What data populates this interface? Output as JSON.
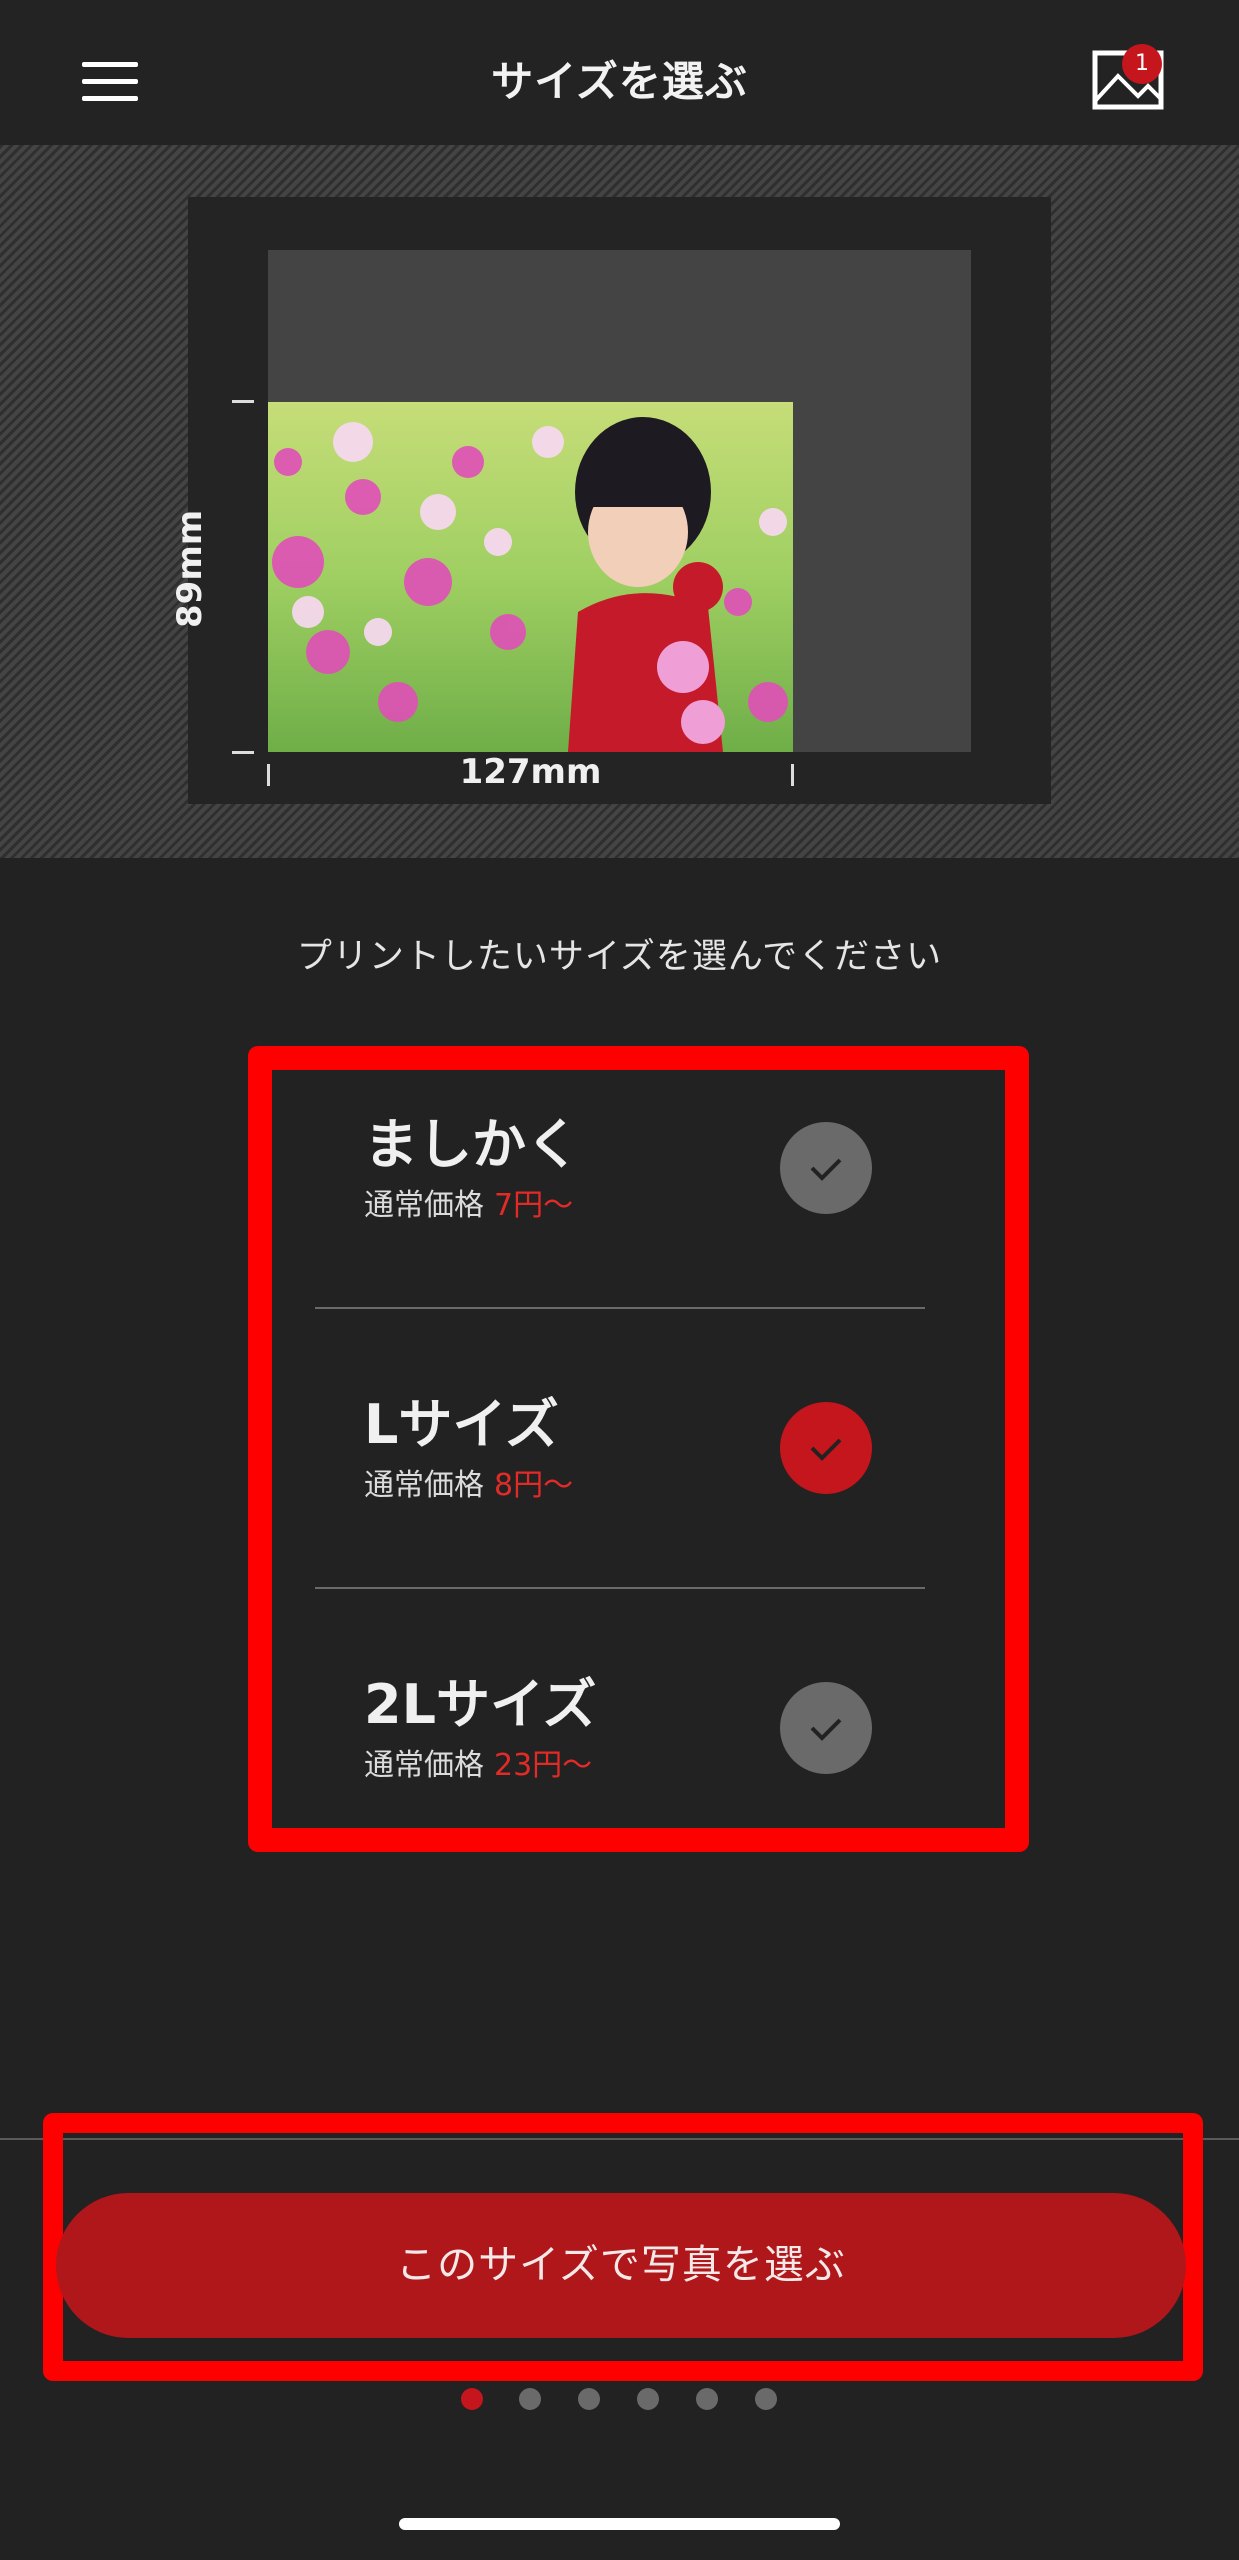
{
  "header": {
    "title": "サイズを選ぶ",
    "menu_icon": "hamburger-menu-icon",
    "gallery_icon": "image-icon",
    "badge_count": "1"
  },
  "preview": {
    "height_label": "89mm",
    "width_label": "127mm"
  },
  "instruction": "プリントしたいサイズを選んでください",
  "options": [
    {
      "name": "ましかく",
      "price_label": "通常価格",
      "price": "7円〜",
      "selected": false
    },
    {
      "name": "Lサイズ",
      "price_label": "通常価格",
      "price": "8円〜",
      "selected": true
    },
    {
      "name": "2Lサイズ",
      "price_label": "通常価格",
      "price": "23円〜",
      "selected": false
    }
  ],
  "cta": {
    "label": "このサイズで写真を選ぶ"
  },
  "pagination": {
    "total": 6,
    "current": 1
  },
  "colors": {
    "accent": "#c4161c",
    "price": "#e22b27",
    "annotation": "#ff0000",
    "background": "#222222"
  }
}
